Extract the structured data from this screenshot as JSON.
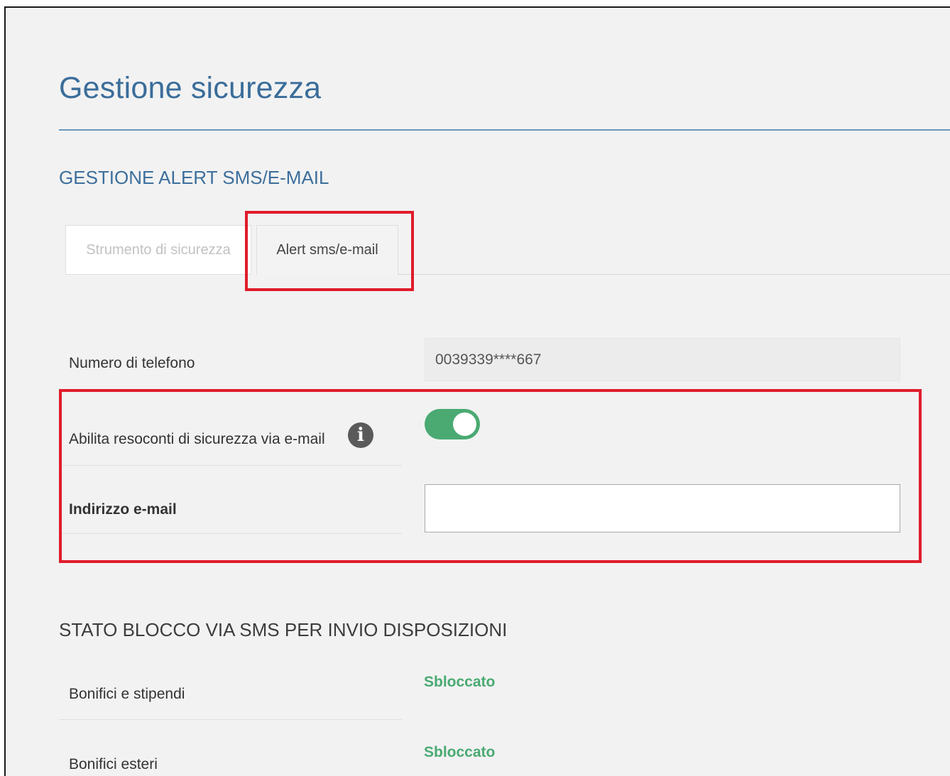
{
  "page": {
    "title": "Gestione sicurezza"
  },
  "alert_section": {
    "heading": "GESTIONE ALERT SMS/E-MAIL",
    "tabs": [
      {
        "label": "Strumento di sicurezza",
        "active": false
      },
      {
        "label": "Alert sms/e-mail",
        "active": true
      }
    ]
  },
  "form": {
    "phone_label": "Numero di telefono",
    "phone_value": "0039339****667",
    "email_reports_label": "Abilita resoconti di sicurezza via e-mail",
    "email_reports_enabled": true,
    "info_icon": "info-circle-icon",
    "email_label": "Indirizzo e-mail",
    "email_value": ""
  },
  "block_section": {
    "heading": "STATO BLOCCO VIA SMS PER INVIO DISPOSIZIONI",
    "rows": [
      {
        "label": "Bonifici e stipendi",
        "status": "Sbloccato"
      },
      {
        "label": "Bonifici esteri",
        "status": "Sbloccato"
      }
    ]
  },
  "colors": {
    "title": "#3a6d9a",
    "accent_green": "#4aaa72",
    "highlight_red": "#e01c2b"
  }
}
